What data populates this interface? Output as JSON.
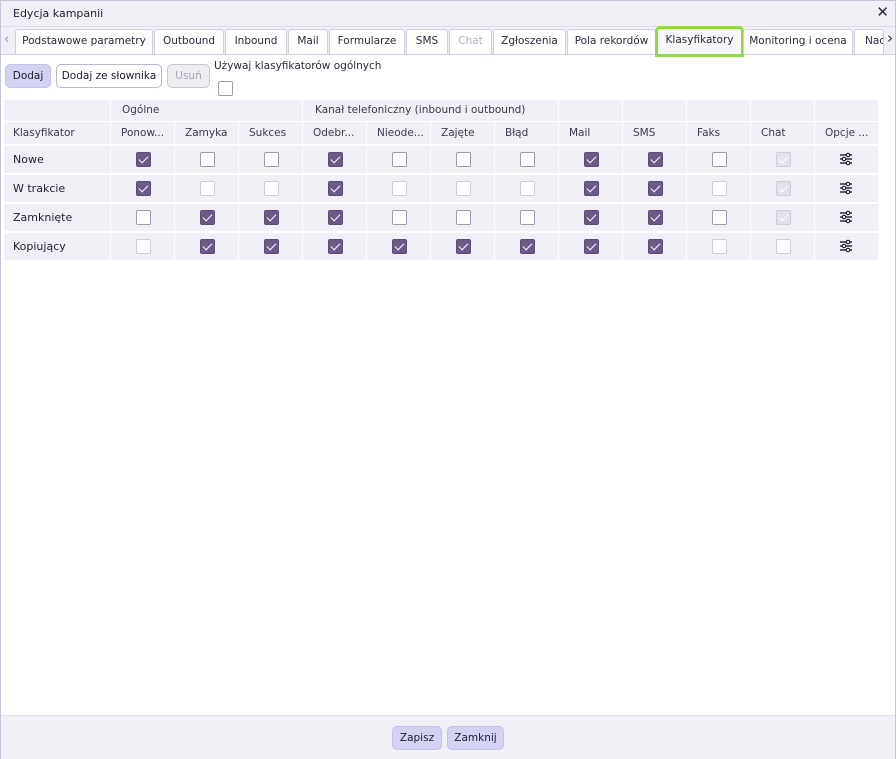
{
  "window": {
    "title": "Edycja kampanii"
  },
  "tabs": [
    {
      "label": "Podstawowe parametry",
      "disabled": false,
      "active": false
    },
    {
      "label": "Outbound",
      "disabled": false,
      "active": false
    },
    {
      "label": "Inbound",
      "disabled": false,
      "active": false
    },
    {
      "label": "Mail",
      "disabled": false,
      "active": false
    },
    {
      "label": "Formularze",
      "disabled": false,
      "active": false
    },
    {
      "label": "SMS",
      "disabled": false,
      "active": false
    },
    {
      "label": "Chat",
      "disabled": true,
      "active": false
    },
    {
      "label": "Zgłoszenia",
      "disabled": false,
      "active": false
    },
    {
      "label": "Pola rekordów",
      "disabled": false,
      "active": false
    },
    {
      "label": "Klasyfikatory",
      "disabled": false,
      "active": true
    },
    {
      "label": "Monitoring i ocena",
      "disabled": false,
      "active": false
    },
    {
      "label": "Nad",
      "disabled": false,
      "active": false
    }
  ],
  "toolbar": {
    "add_label": "Dodaj",
    "add_from_dict_label": "Dodaj ze słownika",
    "remove_label": "Usuń",
    "use_global_label": "Używaj klasyfikatorów ogólnych",
    "use_global_checked": false
  },
  "table": {
    "group_headers": {
      "general": "Ogólne",
      "phone": "Kanał telefoniczny (inbound i outbound)"
    },
    "columns": [
      "Klasyfikator",
      "Ponow...",
      "Zamyka",
      "Sukces",
      "Odebr...",
      "Nieode...",
      "Zajęte",
      "Błąd",
      "Mail",
      "SMS",
      "Faks",
      "Chat",
      "Opcje ..."
    ],
    "rows": [
      {
        "name": "Nowe",
        "flags": [
          "checked",
          "empty",
          "empty",
          "checked",
          "empty",
          "empty",
          "empty",
          "checked",
          "checked",
          "empty",
          "dis-checked"
        ]
      },
      {
        "name": "W trakcie",
        "flags": [
          "checked",
          "dis",
          "dis",
          "checked",
          "dis",
          "dis",
          "dis",
          "checked",
          "checked",
          "dis",
          "dis-checked"
        ]
      },
      {
        "name": "Zamknięte",
        "flags": [
          "empty",
          "checked",
          "checked",
          "checked",
          "empty",
          "empty",
          "empty",
          "checked",
          "checked",
          "empty",
          "dis-checked"
        ]
      },
      {
        "name": "Kopiujący",
        "flags": [
          "dis",
          "checked",
          "checked",
          "checked",
          "checked",
          "checked",
          "checked",
          "checked",
          "checked",
          "dis",
          "dis"
        ]
      }
    ],
    "options_icon": "sliders-icon"
  },
  "footer": {
    "save_label": "Zapisz",
    "close_label": "Zamknij"
  },
  "colors": {
    "accent": "#6b5a86",
    "active_tab_outline": "#8fd94a",
    "button_primary": "#d4d2f3"
  }
}
